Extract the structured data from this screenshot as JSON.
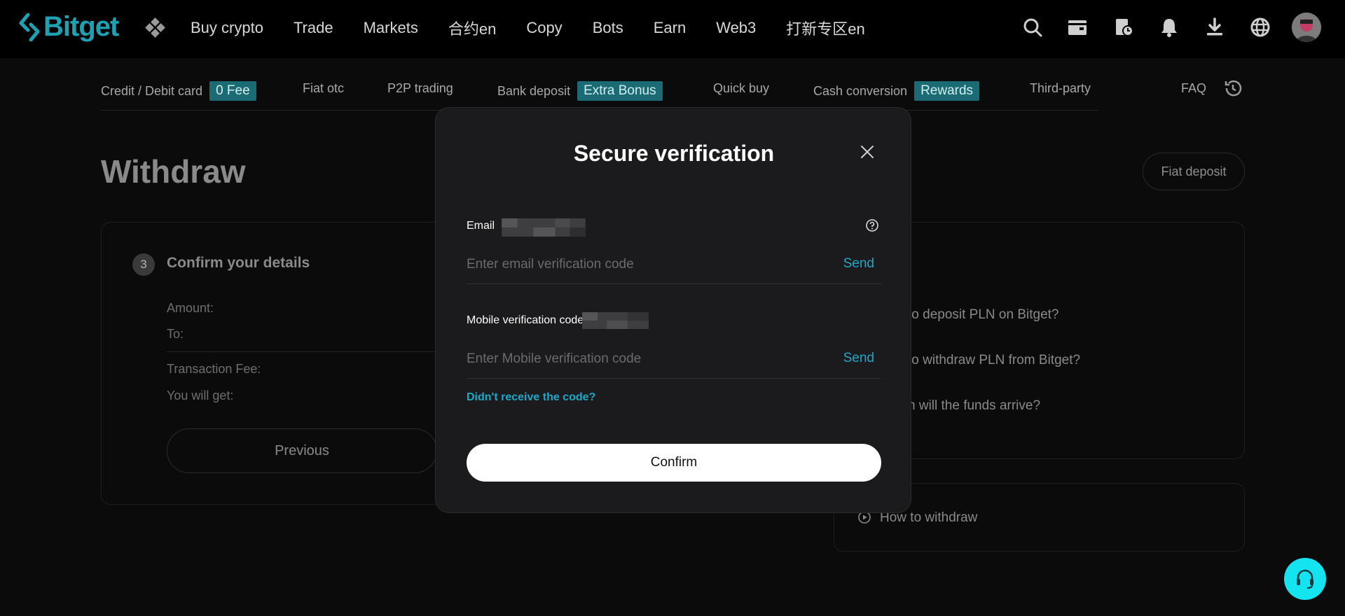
{
  "brand": {
    "name": "Bitget",
    "accent": "#1da2b4"
  },
  "nav": {
    "items": [
      "Buy crypto",
      "Trade",
      "Markets",
      "合约en",
      "Copy",
      "Bots",
      "Earn",
      "Web3",
      "打新专区en"
    ],
    "icons": [
      "search-icon",
      "wallet-icon",
      "orders-icon",
      "bell-icon",
      "download-icon",
      "globe-icon"
    ]
  },
  "subnav": {
    "items": [
      {
        "label": "Credit / Debit card",
        "badge": "0 Fee"
      },
      {
        "label": "Fiat otc"
      },
      {
        "label": "P2P trading"
      },
      {
        "label": "Bank deposit",
        "badge": "Extra Bonus"
      },
      {
        "label": "Quick buy"
      },
      {
        "label": "Cash conversion",
        "badge": "Rewards"
      },
      {
        "label": "Third-party"
      }
    ],
    "faq": "FAQ"
  },
  "page": {
    "title": "Withdraw",
    "fiat_deposit": "Fiat deposit",
    "step": {
      "number": "3",
      "title": "Confirm your details"
    },
    "details": {
      "amount": "Amount:",
      "to": "To:",
      "fee": "Transaction Fee:",
      "get": "You will get:"
    },
    "previous": "Previous",
    "faq_lines": [
      "to deposit PLN on Bitget?",
      "to withdraw PLN from Bitget?",
      "n will the funds arrive?"
    ],
    "how_to": "How to withdraw"
  },
  "modal": {
    "title": "Secure verification",
    "email_label": "Email",
    "email_placeholder": "Enter email verification code",
    "mobile_label": "Mobile verification code",
    "mobile_placeholder": "Enter Mobile verification code",
    "send": "Send",
    "resend": "Didn't receive the code?",
    "confirm": "Confirm"
  }
}
